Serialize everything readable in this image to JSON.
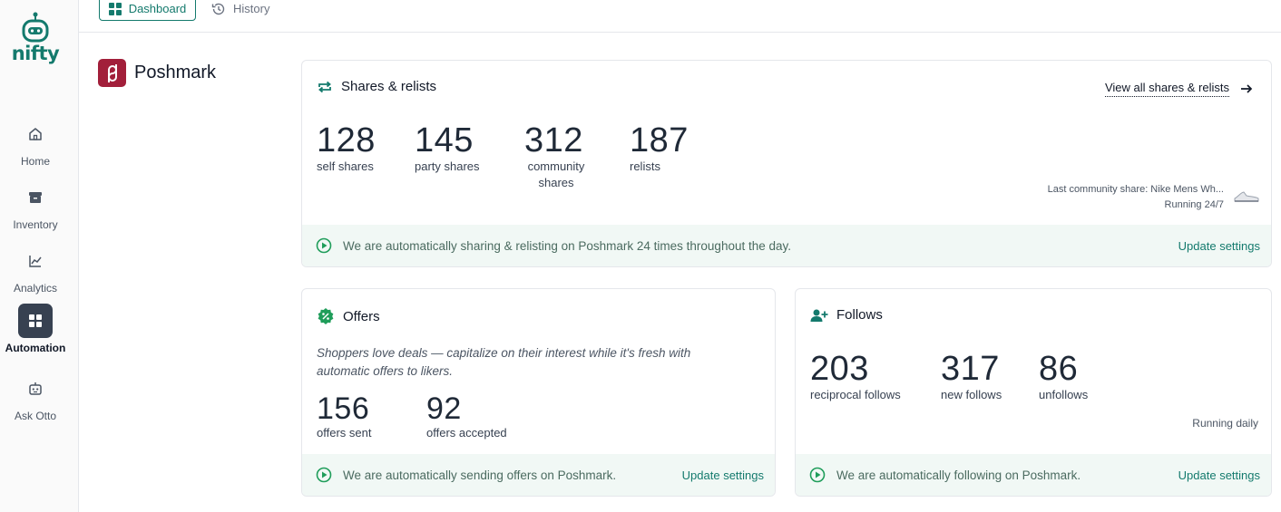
{
  "app": {
    "logo_text": "nifty"
  },
  "nav": {
    "tabs": [
      {
        "label": "Dashboard",
        "active": true
      },
      {
        "label": "History",
        "active": false
      }
    ]
  },
  "sidebar": {
    "items": [
      {
        "label": "Home",
        "icon": "home-icon"
      },
      {
        "label": "Inventory",
        "icon": "archive-icon"
      },
      {
        "label": "Analytics",
        "icon": "chart-icon"
      },
      {
        "label": "Automation",
        "icon": "grid-icon",
        "active": true
      },
      {
        "label": "Ask Otto",
        "icon": "robot-icon"
      }
    ]
  },
  "platform": {
    "name": "Poshmark",
    "brand_color": "#a21f3a"
  },
  "shares": {
    "title": "Shares & relists",
    "view_all": "View all shares & relists",
    "stats": [
      {
        "value": "128",
        "label": "self shares"
      },
      {
        "value": "145",
        "label": "party shares"
      },
      {
        "value": "312",
        "label": "community shares"
      },
      {
        "value": "187",
        "label": "relists"
      }
    ],
    "last_share": "Last community share: Nike Mens Wh...",
    "running": "Running 24/7",
    "footer": "We are automatically sharing & relisting on Poshmark 24 times throughout the day.",
    "update": "Update settings"
  },
  "offers": {
    "title": "Offers",
    "tagline": "Shoppers love deals — capitalize on their interest while it's fresh with automatic offers to likers.",
    "stats": [
      {
        "value": "156",
        "label": "offers sent"
      },
      {
        "value": "92",
        "label": "offers accepted"
      }
    ],
    "footer": "We are automatically sending offers on Poshmark.",
    "update": "Update settings"
  },
  "follows": {
    "title": "Follows",
    "stats": [
      {
        "value": "203",
        "label": "reciprocal follows"
      },
      {
        "value": "317",
        "label": "new follows"
      },
      {
        "value": "86",
        "label": "unfollows"
      }
    ],
    "running": "Running daily",
    "footer": "We are automatically following on Poshmark.",
    "update": "Update settings"
  },
  "colors": {
    "accent": "#147a6d",
    "footer_bg": "#f1f8f5",
    "active_nav": "#374151"
  }
}
